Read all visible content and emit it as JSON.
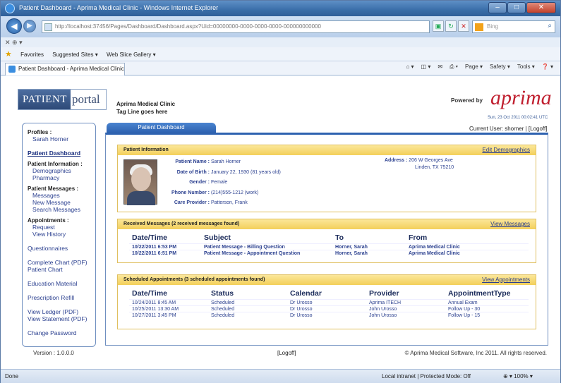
{
  "window": {
    "title": "Patient Dashboard - Aprima Medical Clinic - Windows Internet Explorer",
    "controls": [
      "–",
      "□",
      "✕"
    ]
  },
  "browser": {
    "url": "http://localhost:37456/Pages/Dashboard/Dashboard.aspx?Uid=00000000-0000-0000-0000-000000000000",
    "search_placeholder": "Bing",
    "x_row": "✕ ⊕ ▾",
    "favorites": "Favorites",
    "suggested_sites": "Suggested Sites ▾",
    "web_slice": "Web Slice Gallery ▾",
    "tab_title": "Patient Dashboard - Aprima Medical Clinic",
    "commands": [
      "Page ▾",
      "Safety ▾",
      "Tools ▾",
      "❓ ▾"
    ]
  },
  "header": {
    "logo_left": "PATIENT",
    "logo_right": "portal",
    "clinic_name": "Aprima Medical Clinic",
    "tagline": "Tag Line goes here",
    "powered_by": "Powered by",
    "brand": "aprima",
    "datetime": "Sun, 23 Oct 2011 00:02:41 UTC",
    "current_user": "Current User:  shorner  |",
    "logoff": "[Logoff]"
  },
  "sidebar": {
    "profiles_heading": "Profiles :",
    "profile_name": "Sarah Horner",
    "dashboard": "Patient Dashboard",
    "info_heading": "Patient Information :",
    "info_items": [
      "Demographics",
      "Pharmacy"
    ],
    "messages_heading": "Patient Messages :",
    "message_items": [
      "Messages",
      "New Message",
      "Search Messages"
    ],
    "appointments_heading": "Appointments :",
    "appointment_items": [
      "Request",
      "View History"
    ],
    "links": [
      "Questionnaires",
      "Complete Chart (PDF)",
      "Patient Chart",
      "Education Material",
      "Prescription Refill",
      "View Ledger (PDF)",
      "View Statement (PDF)",
      "Change Password"
    ]
  },
  "main": {
    "tab_label": "Patient Dashboard",
    "patient_info": {
      "heading": "Patient Information",
      "edit_link": "Edit Demographics",
      "labels": [
        "Patient Name :",
        "Date of Birth :",
        "Gender :",
        "Phone Number :",
        "Care Provider :"
      ],
      "values": [
        "Sarah Horner",
        "January 22, 1930  (81 years old)",
        "Female",
        "(214)555-1212 (work)",
        "Patterson, Frank"
      ],
      "address_label": "Address :",
      "address_lines": [
        "206 W Georges Ave",
        "Linden, TX 75210"
      ]
    },
    "messages": {
      "heading": "Received Messages    (2 received messages found)",
      "view_link": "View Messages",
      "columns": [
        "Date/Time",
        "Subject",
        "To",
        "From"
      ],
      "rows": [
        [
          "10/22/2011 6:53 PM",
          "Patient Message - Billing Question",
          "Horner, Sarah",
          "Aprima Medical Clinic"
        ],
        [
          "10/22/2011 6:51 PM",
          "Patient Message - Appointment Question",
          "Horner, Sarah",
          "Aprima Medical Clinic"
        ]
      ]
    },
    "appointments": {
      "heading": "Scheduled Appointments    (3 scheduled appointments found)",
      "view_link": "View Appointments",
      "columns": [
        "Date/Time",
        "Status",
        "Calendar",
        "Provider",
        "AppointmentType"
      ],
      "rows": [
        [
          "10/24/2011 8:45 AM",
          "Scheduled",
          "Dr Urosso",
          "Aprima ITECH",
          "Annual Exam"
        ],
        [
          "10/25/2011 13:30 AM",
          "Scheduled",
          "Dr Urosso",
          "John Urosso",
          "Follow Up - 30"
        ],
        [
          "10/27/2011 3:45 PM",
          "Scheduled",
          "Dr Urosso",
          "John Urosso",
          "Follow Up - 15"
        ]
      ]
    }
  },
  "footer": {
    "version": "Version  :  1.0.0.0",
    "logoff": "[Logoff]",
    "copyright": "© Aprima Medical Software, Inc 2011.  All rights reserved."
  },
  "statusbar": {
    "left": "Done",
    "zone": "Local intranet | Protected Mode: Off",
    "zoom": "⊕ ▾  100% ▾"
  },
  "colors": {
    "accent": "#2e62b0",
    "section_header": "#f3cf5a",
    "link": "#2a3f8f",
    "brand_red": "#c01f2f"
  }
}
